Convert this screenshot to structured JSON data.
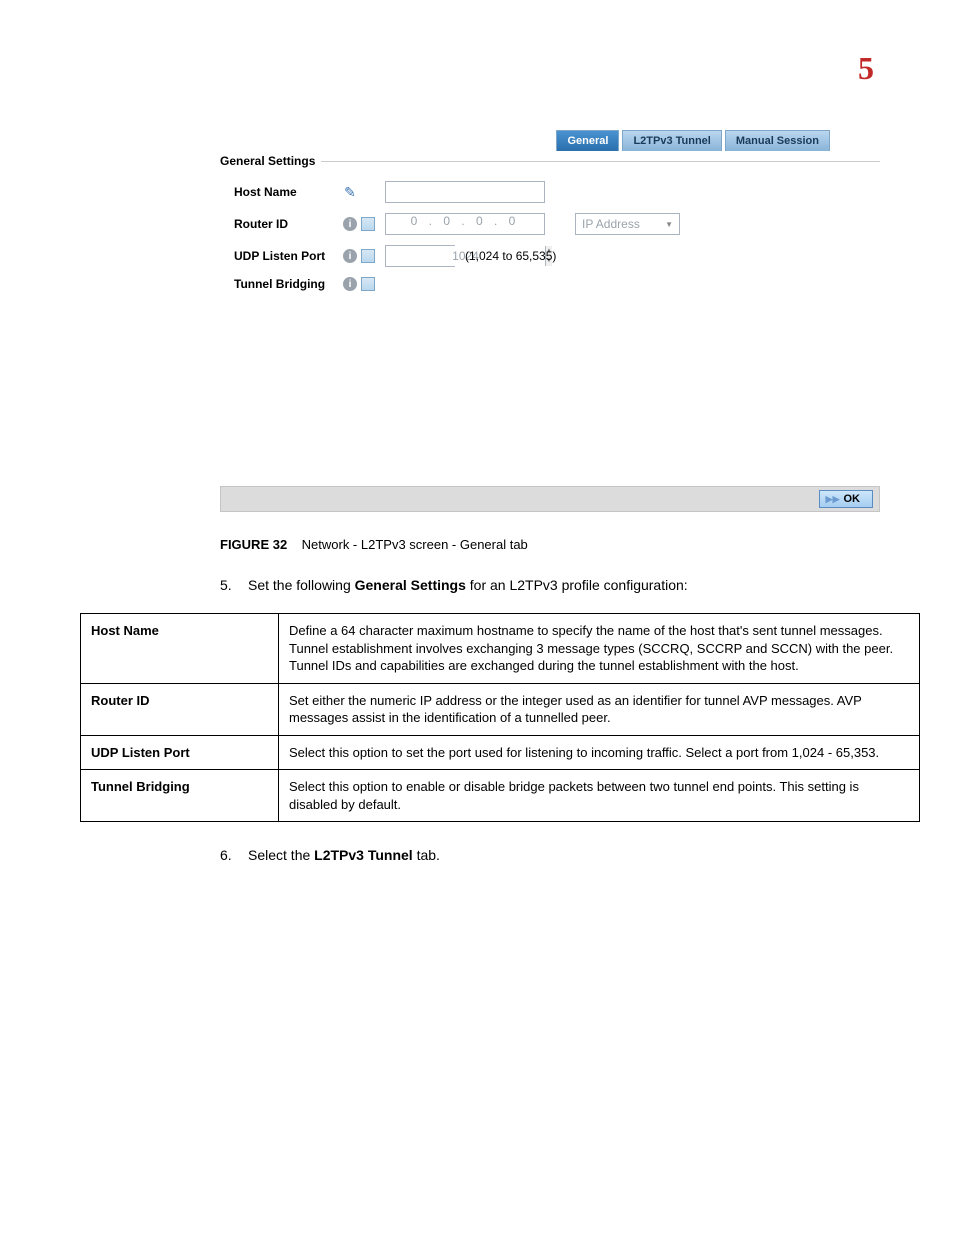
{
  "chapter": "5",
  "tabs": {
    "general": "General",
    "l2tpv3_tunnel": "L2TPv3 Tunnel",
    "manual_session": "Manual Session"
  },
  "fieldset": {
    "legend": "General Settings"
  },
  "form": {
    "host_name": {
      "label": "Host Name",
      "value": ""
    },
    "router_id": {
      "label": "Router ID",
      "ip_value": "0  .  0  .  0  .  0",
      "dropdown": "IP Address"
    },
    "udp_listen_port": {
      "label": "UDP Listen Port",
      "value": "1024",
      "range": "(1,024 to 65,535)"
    },
    "tunnel_bridging": {
      "label": "Tunnel Bridging"
    }
  },
  "footer": {
    "ok": "OK"
  },
  "figure": {
    "label": "FIGURE 32",
    "caption": "Network - L2TPv3 screen - General tab"
  },
  "steps": {
    "s5": {
      "num": "5.",
      "pre": "Set the following ",
      "bold": "General Settings",
      "post": " for an L2TPv3 profile configuration:"
    },
    "s6": {
      "num": "6.",
      "pre": "Select the ",
      "bold": "L2TPv3 Tunnel",
      "post": " tab."
    }
  },
  "table": {
    "r1": {
      "name": "Host Name",
      "desc": "Define a 64 character maximum hostname to specify the name of the host that's sent tunnel messages. Tunnel establishment involves exchanging 3 message types (SCCRQ, SCCRP and SCCN) with the peer. Tunnel IDs and capabilities are exchanged during the tunnel establishment with the host."
    },
    "r2": {
      "name": "Router ID",
      "desc": "Set either the numeric IP address or the integer used as an identifier for tunnel AVP messages. AVP messages assist in the identification of a tunnelled peer."
    },
    "r3": {
      "name": "UDP Listen Port",
      "desc": "Select this option to set the port used for listening to incoming traffic. Select a port from 1,024 - 65,353."
    },
    "r4": {
      "name": "Tunnel Bridging",
      "desc": "Select this option to enable or disable bridge packets between two tunnel end points. This setting is disabled by default."
    }
  }
}
